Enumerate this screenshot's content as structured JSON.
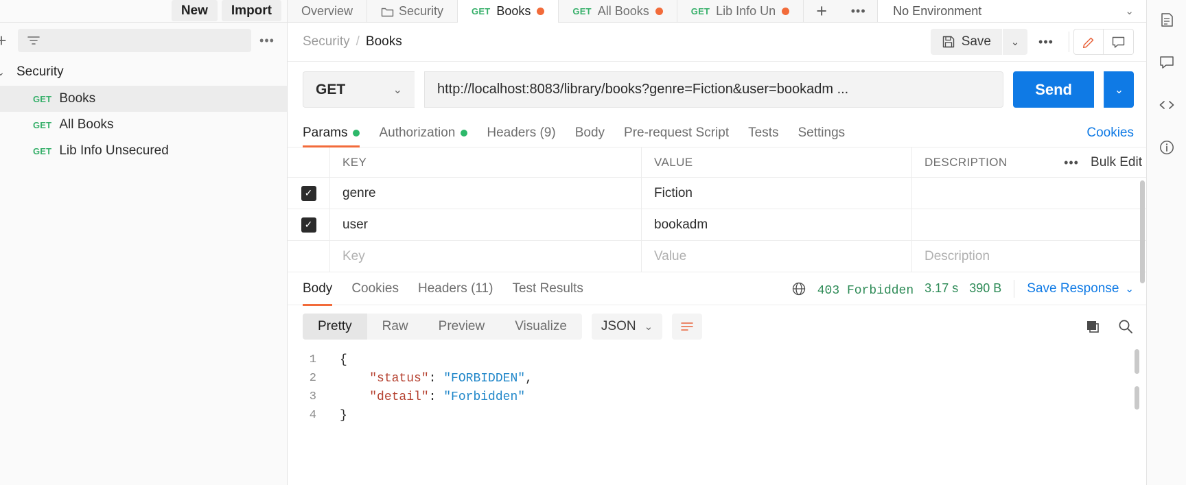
{
  "sidebar": {
    "new_label": "New",
    "import_label": "Import",
    "filter_placeholder": "",
    "more_icon": "ellipsis-icon",
    "collection": {
      "name": "Security",
      "expanded_icon": "chevron-down-icon"
    },
    "items": [
      {
        "method": "GET",
        "label": "Books",
        "active": true
      },
      {
        "method": "GET",
        "label": "All Books",
        "active": false
      },
      {
        "method": "GET",
        "label": "Lib Info Unsecured",
        "active": false
      }
    ]
  },
  "tabbar": {
    "tabs": [
      {
        "label": "Overview",
        "method": "",
        "unsaved": false,
        "active": false,
        "icon": ""
      },
      {
        "label": "Security",
        "method": "",
        "unsaved": false,
        "active": false,
        "icon": "folder-icon"
      },
      {
        "label": "Books",
        "method": "GET",
        "unsaved": true,
        "active": true,
        "icon": ""
      },
      {
        "label": "All Books",
        "method": "GET",
        "unsaved": true,
        "active": false,
        "icon": ""
      },
      {
        "label": "Lib Info Un",
        "method": "GET",
        "unsaved": true,
        "active": false,
        "icon": ""
      }
    ],
    "add_tab_icon": "plus-icon",
    "more_icon": "ellipsis-icon",
    "environment": "No Environment",
    "environment_caret": "chevron-down-icon"
  },
  "request_header": {
    "breadcrumb_parent": "Security",
    "breadcrumb_sep": "/",
    "breadcrumb_current": "Books",
    "save_label": "Save",
    "save_icon": "floppy-disk-icon",
    "save_caret_icon": "chevron-down-icon",
    "more_icon": "ellipsis-icon",
    "edit_icon": "pencil-icon",
    "comment_icon": "comment-icon"
  },
  "url_bar": {
    "method": "GET",
    "method_caret": "chevron-down-icon",
    "url": "http://localhost:8083/library/books?genre=Fiction&user=bookadm ...",
    "send_label": "Send",
    "send_caret_icon": "chevron-down-icon"
  },
  "request_tabs": {
    "tabs": [
      {
        "label": "Params",
        "badge_dot": true,
        "active": true
      },
      {
        "label": "Authorization",
        "badge_dot": true,
        "active": false
      },
      {
        "label": "Headers (9)",
        "badge_dot": false,
        "active": false
      },
      {
        "label": "Body",
        "badge_dot": false,
        "active": false
      },
      {
        "label": "Pre-request Script",
        "badge_dot": false,
        "active": false
      },
      {
        "label": "Tests",
        "badge_dot": false,
        "active": false
      },
      {
        "label": "Settings",
        "badge_dot": false,
        "active": false
      }
    ],
    "cookies_label": "Cookies"
  },
  "params_table": {
    "columns": [
      "KEY",
      "VALUE",
      "DESCRIPTION"
    ],
    "more_icon": "ellipsis-icon",
    "bulk_edit_label": "Bulk Edit",
    "rows": [
      {
        "checked": true,
        "key": "genre",
        "value": "Fiction",
        "description": ""
      },
      {
        "checked": true,
        "key": "user",
        "value": "bookadm",
        "description": ""
      }
    ],
    "new_row_placeholders": {
      "key": "Key",
      "value": "Value",
      "description": "Description"
    }
  },
  "response": {
    "tabs": [
      {
        "label": "Body",
        "active": true
      },
      {
        "label": "Cookies",
        "active": false
      },
      {
        "label": "Headers (11)",
        "active": false
      },
      {
        "label": "Test Results",
        "active": false
      }
    ],
    "globe_icon": "globe-icon",
    "status": "403 Forbidden",
    "time": "3.17 s",
    "size": "390 B",
    "save_response_label": "Save Response",
    "save_response_caret": "chevron-down-icon",
    "view_modes": [
      {
        "label": "Pretty",
        "active": true
      },
      {
        "label": "Raw",
        "active": false
      },
      {
        "label": "Preview",
        "active": false
      },
      {
        "label": "Visualize",
        "active": false
      }
    ],
    "format": "JSON",
    "format_caret": "chevron-down-icon",
    "wrap_icon": "word-wrap-icon",
    "copy_icon": "copy-icon",
    "search_icon": "search-icon",
    "body_lines": [
      {
        "num": "1",
        "tokens": [
          {
            "t": "{",
            "c": "p"
          }
        ]
      },
      {
        "num": "2",
        "tokens": [
          {
            "t": "    ",
            "c": "p"
          },
          {
            "t": "\"status\"",
            "c": "k"
          },
          {
            "t": ": ",
            "c": "p"
          },
          {
            "t": "\"FORBIDDEN\"",
            "c": "s"
          },
          {
            "t": ",",
            "c": "p"
          }
        ]
      },
      {
        "num": "3",
        "tokens": [
          {
            "t": "    ",
            "c": "p"
          },
          {
            "t": "\"detail\"",
            "c": "k"
          },
          {
            "t": ": ",
            "c": "p"
          },
          {
            "t": "\"Forbidden\"",
            "c": "s"
          }
        ]
      },
      {
        "num": "4",
        "tokens": [
          {
            "t": "}",
            "c": "p"
          }
        ]
      }
    ]
  },
  "right_rail": {
    "icons": [
      "documentation-icon",
      "comment-icon",
      "code-icon",
      "info-icon"
    ]
  },
  "colors": {
    "accent_orange": "#f26b3a",
    "send_blue": "#0f7ae5",
    "link_blue": "#0f7ae5",
    "get_green": "#38b06b",
    "status_green": "#2e8b57",
    "dot_green": "#2db86a"
  }
}
